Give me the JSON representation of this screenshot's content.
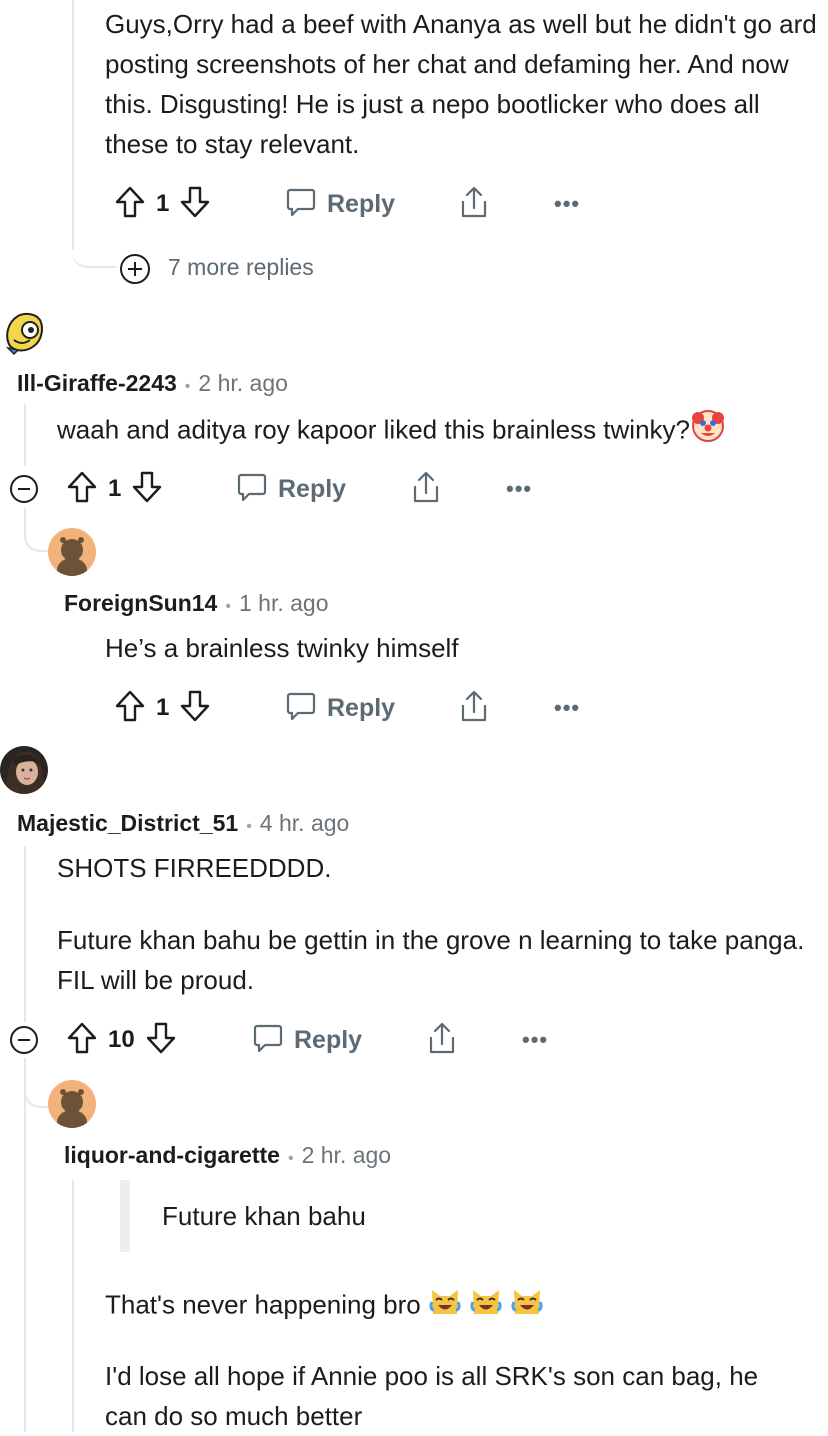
{
  "comments": [
    {
      "body": "Guys,Orry had a beef with Ananya as well but he didn't go ard posting screenshots of her chat and defaming her. And now this. Disgusting! He is just a nepo bootlicker who does all these to stay relevant.",
      "votes": "1",
      "reply_label": "Reply",
      "more_replies": "7 more replies"
    },
    {
      "author": "Ill-Giraffe-2243",
      "time": "2 hr. ago",
      "body": "waah and aditya roy kapoor liked this brainless twinky?",
      "votes": "1",
      "reply_label": "Reply"
    },
    {
      "author": "ForeignSun14",
      "time": "1 hr. ago",
      "body": "He’s a brainless twinky himself",
      "votes": "1",
      "reply_label": "Reply"
    },
    {
      "author": "Majestic_District_51",
      "time": "4 hr. ago",
      "body_p1": "SHOTS FIRREEDDDD.",
      "body_p2": "Future khan bahu be gettin in the grove n learning to take panga. FIL will be proud.",
      "votes": "10",
      "reply_label": "Reply"
    },
    {
      "author": "liquor-and-cigarette",
      "time": "2 hr. ago",
      "quote": "Future khan bahu",
      "body_p1": "That's never happening bro",
      "body_p2": "I'd lose all hope if Annie poo is all SRK's son can bag, he can do so much better"
    }
  ],
  "icons": {
    "upvote": "arrow-up-outline-icon",
    "downvote": "arrow-down-outline-icon",
    "reply": "speech-bubble-icon",
    "share": "share-upload-icon",
    "more": "ellipsis-icon",
    "clown": "clown-face-emoji",
    "laugh": "laughing-cat-emoji"
  },
  "colors": {
    "text": "#1c1c1c",
    "meta": "#6b7479",
    "action": "#5c6b73",
    "thread_line": "#e5e8ea",
    "avatar_orange": "#f3b27a"
  }
}
